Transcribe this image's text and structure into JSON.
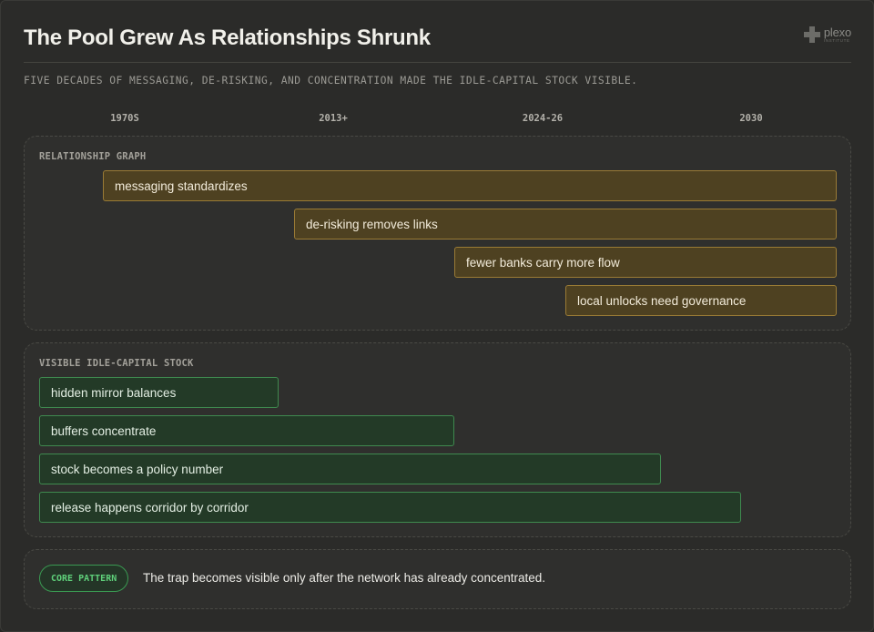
{
  "header": {
    "title": "The Pool Grew As Relationships Shrunk",
    "subtitle": "FIVE DECADES OF MESSAGING, DE-RISKING, AND CONCENTRATION MADE THE IDLE-CAPITAL STOCK VISIBLE.",
    "logo_name": "plexo",
    "logo_sub": "INSTITUTE",
    "logo_icon": "plus-icon"
  },
  "timeline": {
    "axis": [
      "1970S",
      "2013+",
      "2024-26",
      "2030"
    ]
  },
  "relationship_panel": {
    "title": "RELATIONSHIP GRAPH",
    "color": "#9a7b35",
    "bars": [
      {
        "label": "messaging standardizes"
      },
      {
        "label": "de-risking removes links"
      },
      {
        "label": "fewer banks carry more flow"
      },
      {
        "label": "local unlocks need governance"
      }
    ]
  },
  "idle_panel": {
    "title": "VISIBLE IDLE-CAPITAL STOCK",
    "color": "#3f8a4f",
    "bars": [
      {
        "label": "hidden mirror balances"
      },
      {
        "label": "buffers concentrate"
      },
      {
        "label": "stock becomes a policy number"
      },
      {
        "label": "release happens corridor by corridor"
      }
    ]
  },
  "footer": {
    "badge": "CORE PATTERN",
    "badge_color": "#5fd07a",
    "text": "The trap becomes visible only after the network has already concentrated."
  }
}
